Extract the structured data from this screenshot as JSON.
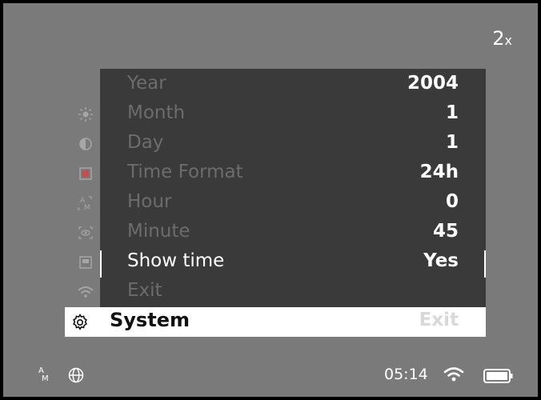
{
  "zoom": {
    "value": "2",
    "suffix": "x"
  },
  "side_icons": [
    {
      "name": "brightness-icon",
      "glyph": "☀"
    },
    {
      "name": "contrast-icon",
      "glyph": "◐"
    },
    {
      "name": "record-icon",
      "glyph": "■"
    },
    {
      "name": "auto-mode-icon",
      "glyph": "A"
    },
    {
      "name": "eye-detection-icon",
      "glyph": "◉"
    },
    {
      "name": "palette-icon",
      "glyph": "▣"
    },
    {
      "name": "wifi-icon",
      "glyph": "≋"
    }
  ],
  "menu": {
    "rows": [
      {
        "label": "Year",
        "value": "2004"
      },
      {
        "label": "Month",
        "value": "1"
      },
      {
        "label": "Day",
        "value": "1"
      },
      {
        "label": "Time Format",
        "value": "24h"
      },
      {
        "label": "Hour",
        "value": "0"
      },
      {
        "label": "Minute",
        "value": "45"
      },
      {
        "label": "Show time",
        "value": "Yes"
      },
      {
        "label": "Exit",
        "value": ""
      }
    ],
    "selected_index": 6
  },
  "system": {
    "label": "System",
    "exit_label": "Exit"
  },
  "status": {
    "time": "05:14",
    "am_top": "A",
    "am_bottom": "M"
  },
  "colors": {
    "background": "#7a7a7a",
    "panel": "#3a3a3a",
    "dim_text": "#6c6c6c",
    "highlight": "#ffffff"
  }
}
